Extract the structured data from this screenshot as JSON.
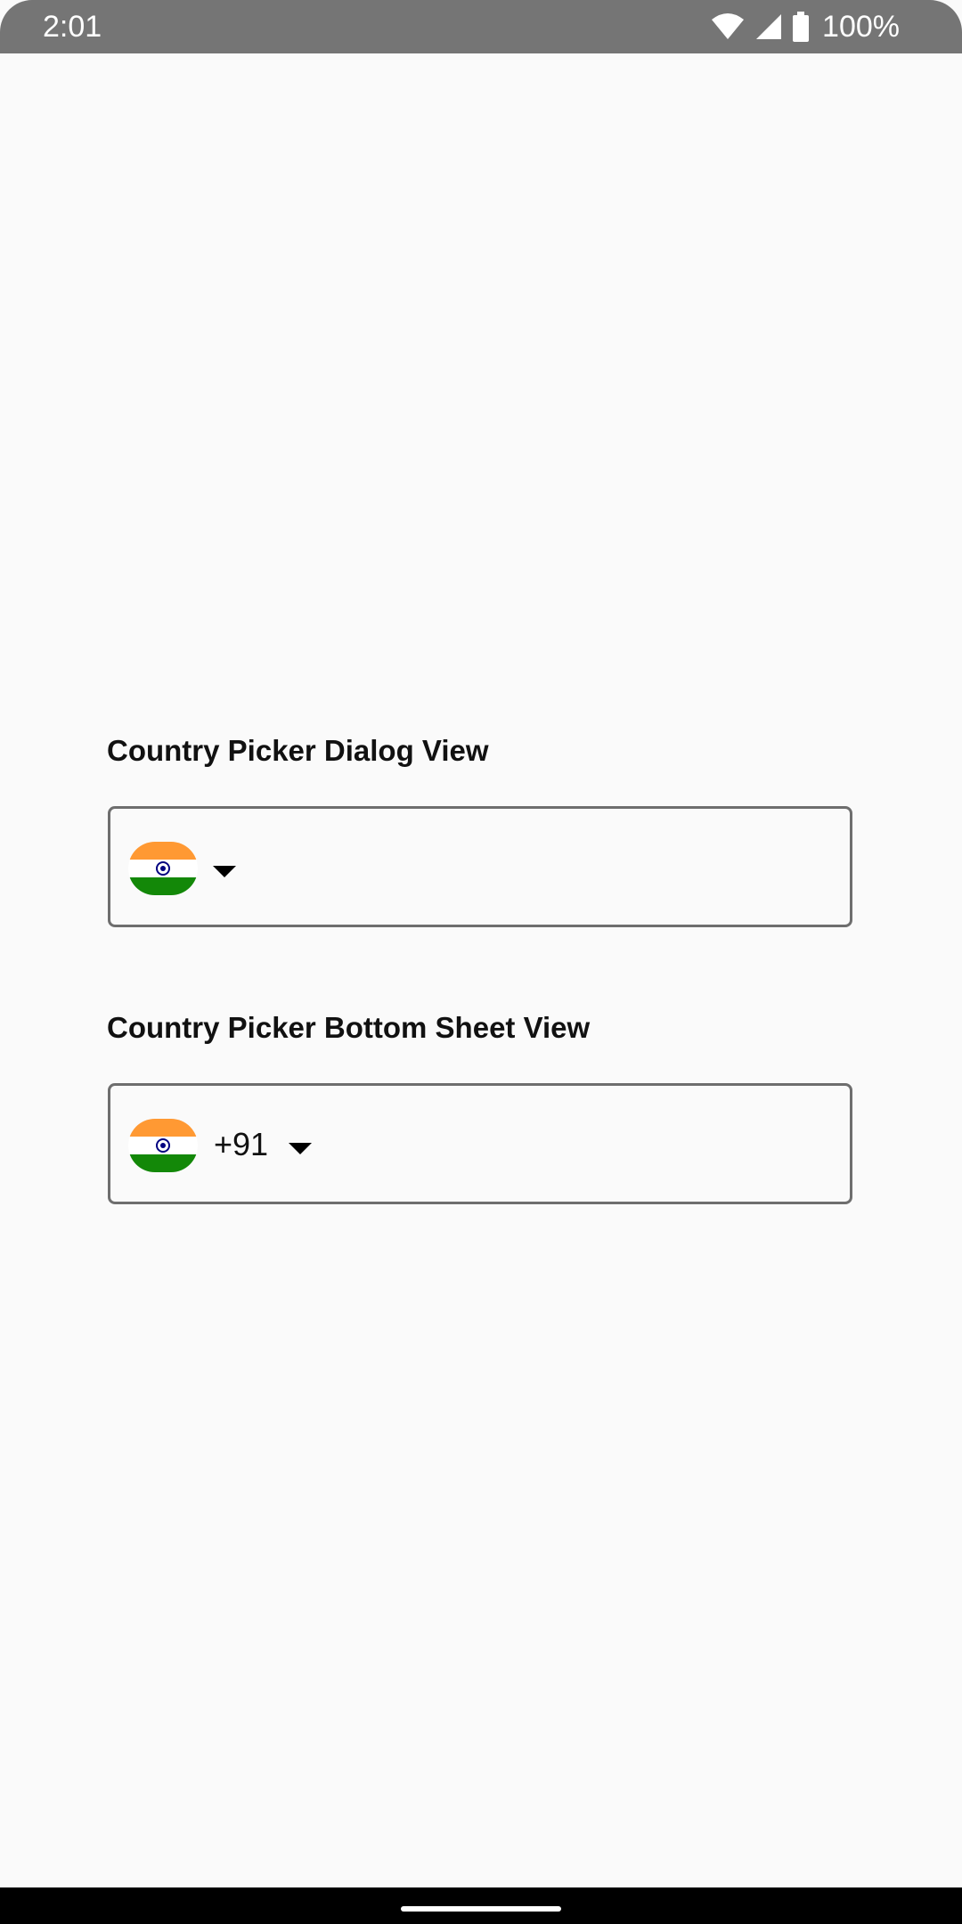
{
  "status_bar": {
    "time": "2:01",
    "battery": "100%",
    "icons": [
      "wifi-icon",
      "signal-icon",
      "battery-icon"
    ]
  },
  "dialog_picker": {
    "title": "Country Picker Dialog View",
    "country_flag": "india-flag-icon",
    "arrow": "dropdown-arrow-icon"
  },
  "bottom_sheet_picker": {
    "title": "Country Picker Bottom Sheet View",
    "country_flag": "india-flag-icon",
    "dial_code": "+91",
    "arrow": "dropdown-arrow-icon"
  },
  "colors": {
    "background": "#fafafa",
    "status_bar": "#757575",
    "flag_saffron": "#ff9933",
    "flag_white": "#ffffff",
    "flag_green": "#138808",
    "flag_chakra": "#000080"
  }
}
